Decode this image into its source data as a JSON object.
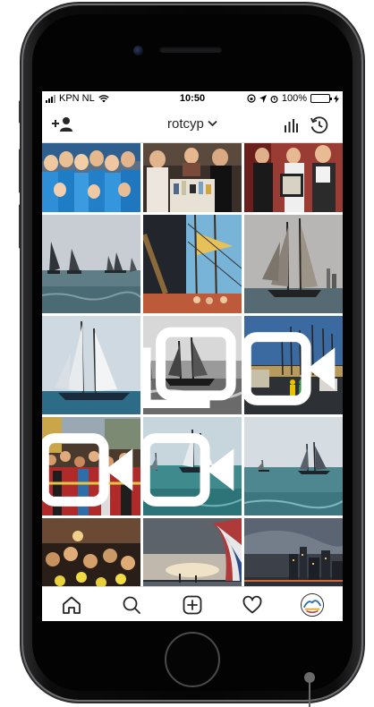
{
  "status": {
    "carrier": "KPN NL",
    "time": "10:50",
    "battery": "100%",
    "battery_level": 1.0
  },
  "header": {
    "username": "rotcyp",
    "dropdown_icon": "chevron-down-icon",
    "add_icon": "add-user-icon",
    "insights_icon": "insights-icon",
    "archive_icon": "archive-icon"
  },
  "grid": {
    "posts": [
      {
        "subject": "group in blue jackets",
        "type": "photo"
      },
      {
        "subject": "people around a table",
        "type": "photo"
      },
      {
        "subject": "people holding a frame",
        "type": "photo"
      },
      {
        "subject": "fleet of tall ships",
        "type": "photo"
      },
      {
        "subject": "person with rigging",
        "type": "photo"
      },
      {
        "subject": "schooner sailing",
        "type": "photo"
      },
      {
        "subject": "schooner on sea",
        "type": "photo"
      },
      {
        "subject": "ships black and white",
        "type": "album"
      },
      {
        "subject": "harbor with crowd",
        "type": "video"
      },
      {
        "subject": "crowd at harbor",
        "type": "video"
      },
      {
        "subject": "ships on teal sea",
        "type": "video"
      },
      {
        "subject": "ships on horizon",
        "type": "photo"
      },
      {
        "subject": "party crowd",
        "type": "photo"
      },
      {
        "subject": "sunset with flag",
        "type": "photo"
      },
      {
        "subject": "city skyline at dusk",
        "type": "photo"
      }
    ]
  },
  "nav": {
    "items": [
      "home-icon",
      "search-icon",
      "add-post-icon",
      "heart-icon",
      "profile-avatar"
    ]
  },
  "colors": {
    "battery_green": "#2ed158",
    "divider": "#dbdbdb",
    "icon": "#262626"
  }
}
